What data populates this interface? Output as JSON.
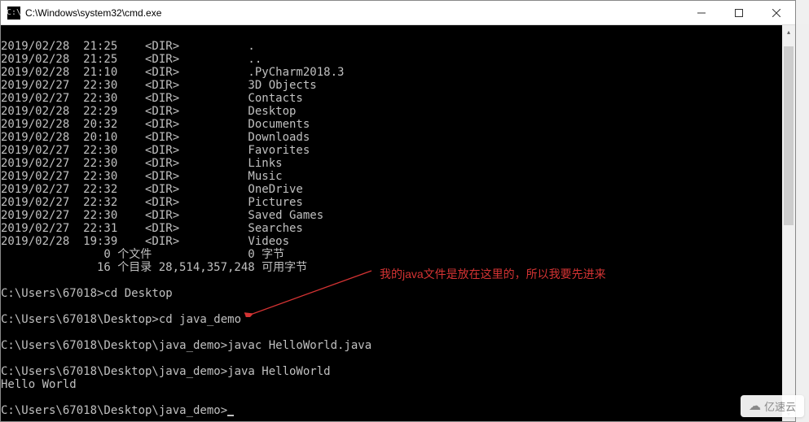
{
  "titlebar": {
    "icon_text": "C:\\",
    "title": "C:\\Windows\\system32\\cmd.exe"
  },
  "dir_listing": [
    {
      "date": "2019/02/28",
      "time": "21:25",
      "type": "<DIR>",
      "name": "."
    },
    {
      "date": "2019/02/28",
      "time": "21:25",
      "type": "<DIR>",
      "name": ".."
    },
    {
      "date": "2019/02/28",
      "time": "21:10",
      "type": "<DIR>",
      "name": ".PyCharm2018.3"
    },
    {
      "date": "2019/02/27",
      "time": "22:30",
      "type": "<DIR>",
      "name": "3D Objects"
    },
    {
      "date": "2019/02/27",
      "time": "22:30",
      "type": "<DIR>",
      "name": "Contacts"
    },
    {
      "date": "2019/02/28",
      "time": "22:29",
      "type": "<DIR>",
      "name": "Desktop"
    },
    {
      "date": "2019/02/28",
      "time": "20:32",
      "type": "<DIR>",
      "name": "Documents"
    },
    {
      "date": "2019/02/28",
      "time": "20:10",
      "type": "<DIR>",
      "name": "Downloads"
    },
    {
      "date": "2019/02/27",
      "time": "22:30",
      "type": "<DIR>",
      "name": "Favorites"
    },
    {
      "date": "2019/02/27",
      "time": "22:30",
      "type": "<DIR>",
      "name": "Links"
    },
    {
      "date": "2019/02/27",
      "time": "22:30",
      "type": "<DIR>",
      "name": "Music"
    },
    {
      "date": "2019/02/27",
      "time": "22:32",
      "type": "<DIR>",
      "name": "OneDrive"
    },
    {
      "date": "2019/02/27",
      "time": "22:32",
      "type": "<DIR>",
      "name": "Pictures"
    },
    {
      "date": "2019/02/27",
      "time": "22:30",
      "type": "<DIR>",
      "name": "Saved Games"
    },
    {
      "date": "2019/02/27",
      "time": "22:31",
      "type": "<DIR>",
      "name": "Searches"
    },
    {
      "date": "2019/02/28",
      "time": "19:39",
      "type": "<DIR>",
      "name": "Videos"
    }
  ],
  "summary": {
    "files_line": "               0 个文件              0 字节",
    "dirs_line": "              16 个目录 28,514,357,248 可用字节"
  },
  "commands": [
    {
      "prompt": "C:\\Users\\67018>",
      "cmd": "cd Desktop"
    },
    {
      "prompt": "C:\\Users\\67018\\Desktop>",
      "cmd": "cd java_demo"
    },
    {
      "prompt": "C:\\Users\\67018\\Desktop\\java_demo>",
      "cmd": "javac HelloWorld.java"
    },
    {
      "prompt": "C:\\Users\\67018\\Desktop\\java_demo>",
      "cmd": "java HelloWorld"
    }
  ],
  "output": {
    "hello": "Hello World"
  },
  "current_prompt": "C:\\Users\\67018\\Desktop\\java_demo>",
  "annotation": {
    "text": "我的java文件是放在这里的，所以我要先进来"
  },
  "watermark": {
    "text": "亿速云"
  }
}
